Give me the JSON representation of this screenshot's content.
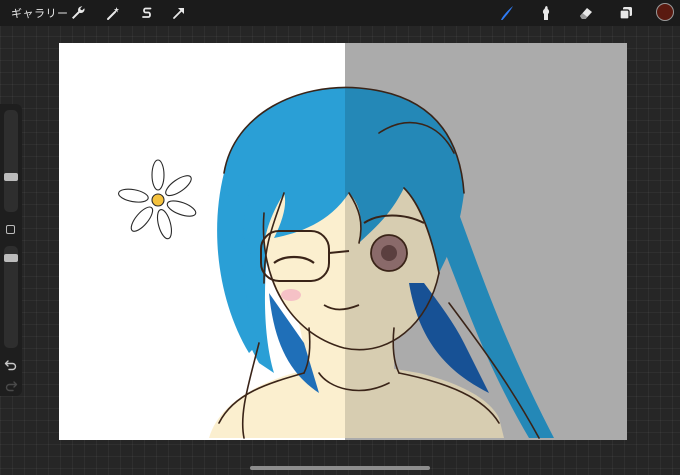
{
  "topbar": {
    "gallery_label": "ギャラリー",
    "left_tools": [
      "wrench-icon",
      "magic-wand-icon",
      "selection-s-icon",
      "transform-arrow-icon"
    ],
    "right_tools": [
      "brush-icon",
      "smudge-icon",
      "eraser-icon",
      "layers-icon"
    ]
  },
  "colors": {
    "accent": "#2f7cf6",
    "active_color": "#5a1a10",
    "hair": "#2a9fd6",
    "skin": "#fbefcf",
    "sketch": "#3a2418",
    "gray_panel": "#c8c8c8"
  },
  "sidebar": {
    "brush_size_level": 0.33,
    "opacity_level": 0.08,
    "modify_icon": "square-modify-icon",
    "undo_icon": "undo-icon",
    "redo_icon": "redo-icon"
  }
}
